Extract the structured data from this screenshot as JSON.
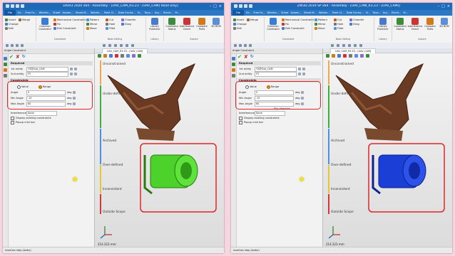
{
  "left": {
    "window_title": "DX/R3 2020 x64 - Assembly - [UAV_CAM_R3.Z3 - [UAV_CAM] Read only]",
    "menu": [
      "File",
      "Dr...",
      "Free Fo...",
      "Wirefra...",
      "Sheet",
      "Assem...",
      "Sheet M...",
      "Weldm...",
      "Point Cl...",
      "Data Excha...",
      "Vi...",
      "Toya...",
      "Ing...",
      "Electr...",
      "M..."
    ],
    "ribbon": {
      "insert": "Insert",
      "merge": "Merge",
      "change": "Change",
      "edit": "Edit",
      "common_constraint": "Common Constraint",
      "mechanical_constraint": "Mechanical Constraint",
      "fix": "Fix",
      "edit_constraint": "Edit Constraint",
      "constraint_group": "Constraint",
      "pattern": "Pattern",
      "cut": "Cut",
      "chamfer": "Chamfer",
      "mirror": "Mirror",
      "hole": "Hole",
      "drag": "Drag",
      "move": "Move",
      "fillet": "Fillet",
      "basic_editing": "Basic Editing",
      "library_publisher": "Library Publisher",
      "library": "Library",
      "constraint_status": "Constraint Status",
      "interference_check": "Interference Check",
      "compare_parts": "Compare Parts",
      "3d_bom": "3D BOM",
      "inquire": "Inquire"
    },
    "panel_title": "Angle Constraint",
    "sections": {
      "required": "Required",
      "constraints": "Constraints"
    },
    "fields": {
      "first_entity_label": "1st entity",
      "first_entity_value": "YZ@Sub_CAM",
      "second_entity_label": "2nd entity",
      "second_entity_value": "F5",
      "value_option": "Value",
      "range_option": "Range",
      "angle_label": "Angle",
      "angle_value": "0",
      "angle_unit": "deg",
      "min_angle_label": "Min Angle",
      "min_angle_value": "-15",
      "min_angle_unit": "deg",
      "max_angle_label": "Max Angle",
      "max_angle_value": "60",
      "max_angle_unit": "deg",
      "interference_label": "Interference",
      "interference_value": "None",
      "display_existing": "Display existing constraints",
      "popup_mini": "Popup mini bar"
    },
    "viewport_tab": "UAV_CAM_R3.Z3 - [UAV_CAM]",
    "statuses": [
      "Unconstrained",
      "Under-defined",
      "Archived",
      "Over-defined",
      "Inconsistent",
      "Outside Scope"
    ],
    "scale": "214.323 mm",
    "status_bar": "Insertion step (Audio)",
    "model_color": "#4cd22a"
  },
  "right": {
    "window_title": "ZW3D 2019 SP x64 - Assembly - [UAV_CAM_R3.Z3 - [UAV_CAM]]",
    "menu": [
      "File",
      "Dr...",
      "Free Fo...",
      "Wirefra...",
      "Sheet",
      "Assem...",
      "Sheet M...",
      "Weldm...",
      "Point Cl...",
      "Data Excha...",
      "Vi...",
      "Toya...",
      "Ing...",
      "Electr...",
      "M..."
    ],
    "ribbon": {
      "insert": "Insert",
      "merge": "Merge",
      "change": "Change",
      "edit": "Edit",
      "common_constraint": "Common Constraint",
      "mechanical_constraint": "Mechanical Constraint",
      "fix": "Fix",
      "edit_constraint": "Edit Constraint",
      "constraint_group": "Constraint",
      "pattern": "Pattern",
      "cut": "Cut",
      "chamfer": "Chamfer",
      "mirror": "Mirror",
      "hole": "Hole",
      "drag": "Drag",
      "move": "Move",
      "fillet": "Fillet",
      "basic_editing": "Basic Editing",
      "library_publisher": "Library Publisher",
      "library": "Library",
      "constraint_status": "Constraint Status",
      "interference_check": "Interference Check",
      "compare_parts": "Compare Parts",
      "3d_bom": "3D BOM",
      "inquire": "Inquire"
    },
    "panel_title": "Angle Constraint",
    "sections": {
      "required": "Required",
      "constraints": "Constraints"
    },
    "fields": {
      "first_entity_label": "1st entity",
      "first_entity_value": "YZ@Sub_CAM",
      "second_entity_label": "2nd entity",
      "second_entity_value": "F5",
      "value_option": "Value",
      "range_option": "Range",
      "angle_label": "Angle",
      "angle_value": "0",
      "angle_unit": "deg",
      "min_angle_label": "Min Angle",
      "min_angle_value": "-15",
      "min_angle_unit": "deg",
      "max_angle_label": "Max Angle",
      "max_angle_value": "60",
      "max_angle_unit": "deg",
      "flip_direction": "Flip direction",
      "interference_label": "Interference",
      "interference_value": "None",
      "display_existing": "Display existing constraints",
      "popup_mini": "Popup mini bar"
    },
    "viewport_tab": "UAV_CAM_R3.Z3 - [UAV_CAM]",
    "statuses": [
      "Unconstrained",
      "Under-defined",
      "Archived",
      "Over-defined",
      "Inconsistent",
      "Outside Scope"
    ],
    "scale": "214.323 mm",
    "status_bar": "Insertion step (Audio)",
    "model_color": "#1b3fd6"
  },
  "colors": {
    "title_blue": "#1f6ab8",
    "annotation_red": "#e0262a",
    "frame_brown": "#6b3a22",
    "bg_pink": "#f7d6e0"
  }
}
